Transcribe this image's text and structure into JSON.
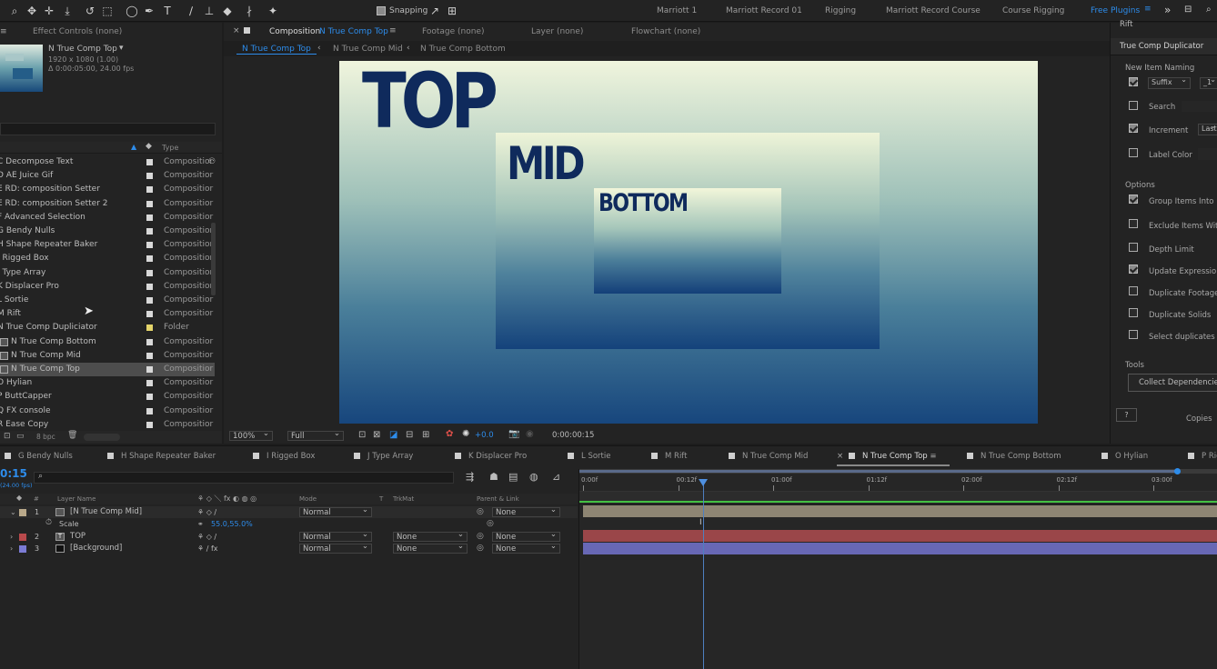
{
  "toolbar": {
    "snapping": "Snapping",
    "workspaces": [
      "Marriott 1",
      "Marriott Record 01",
      "Rigging",
      "Marriott Record Course",
      "Course Rigging",
      "Free Plugins"
    ]
  },
  "project": {
    "effect_controls": "Effect Controls (none)",
    "comp_name": "N True Comp Top",
    "comp_res": "1920 x 1080 (1.00)",
    "comp_dur": "Δ 0:00:05:00, 24.00 fps",
    "type_header": "Type",
    "items": [
      {
        "name": "C Decompose Text",
        "type": "Compositior"
      },
      {
        "name": "D AE Juice Gif",
        "type": "Compositior"
      },
      {
        "name": "E RD: composition Setter",
        "type": "Compositior"
      },
      {
        "name": "E RD: composition Setter 2",
        "type": "Compositior"
      },
      {
        "name": "F Advanced Selection",
        "type": "Compositior"
      },
      {
        "name": "G Bendy Nulls",
        "type": "Compositior"
      },
      {
        "name": "H Shape Repeater Baker",
        "type": "Compositior"
      },
      {
        "name": "I Rigged Box",
        "type": "Compositior"
      },
      {
        "name": "J Type Array",
        "type": "Compositior"
      },
      {
        "name": "K Displacer Pro",
        "type": "Compositior"
      },
      {
        "name": "L Sortie",
        "type": "Compositior"
      },
      {
        "name": "M Rift",
        "type": "Compositior"
      },
      {
        "name": "N True Comp Dupliciator",
        "type": "Folder"
      },
      {
        "name": "N True Comp Bottom",
        "type": "Compositior"
      },
      {
        "name": "N True Comp Mid",
        "type": "Compositior"
      },
      {
        "name": "N True Comp Top",
        "type": "Compositior"
      },
      {
        "name": "O Hylian",
        "type": "Compositior"
      },
      {
        "name": "P ButtCapper",
        "type": "Compositior"
      },
      {
        "name": "Q FX console",
        "type": "Compositior"
      },
      {
        "name": "R Ease Copy",
        "type": "Compositior"
      }
    ],
    "bpc": "8 bpc"
  },
  "viewer": {
    "tab_comp": "Composition",
    "tab_comp_name": "N True Comp Top",
    "tab_footage": "Footage (none)",
    "tab_layer": "Layer (none)",
    "tab_flowchart": "Flowchart (none)",
    "crumbs": [
      "N True Comp Top",
      "N True Comp Mid",
      "N True Comp Bottom"
    ],
    "text_top": "TOP",
    "text_mid": "MID",
    "text_bottom": "BOTTOM",
    "zoom": "100%",
    "quality": "Full",
    "exposure": "+0.0",
    "timecode": "0:00:00:15"
  },
  "tcd": {
    "rift": "Rift",
    "title": "True Comp Duplicator",
    "new_item_naming": "New Item Naming",
    "suffix": "Suffix",
    "suffix_value": "_1",
    "search": "Search",
    "increment": "Increment",
    "increment_value": "Last",
    "label_color": "Label Color",
    "options": "Options",
    "opt_group": "Group Items Into F",
    "opt_exclude": "Exclude Items With",
    "opt_depth": "Depth Limit",
    "opt_update": "Update Expressions",
    "opt_dup_footage": "Duplicate Footage",
    "opt_dup_solids": "Duplicate Solids",
    "opt_select": "Select duplicates",
    "tools": "Tools",
    "collect": "Collect Dependencies",
    "help": "?",
    "copies": "Copies"
  },
  "timeline": {
    "tabs": [
      "G Bendy Nulls",
      "H Shape Repeater Baker",
      "I Rigged Box",
      "J Type Array",
      "K Displacer Pro",
      "L Sortie",
      "M Rift",
      "N True Comp Mid",
      "N True Comp Top",
      "N True Comp Bottom",
      "O Hylian",
      "P Rig"
    ],
    "timecode": "0:15",
    "fps": "(24.00 fps)",
    "col_layer_name": "Layer Name",
    "col_mode": "Mode",
    "col_t": "T",
    "col_trkmat": "TrkMat",
    "col_parent": "Parent & Link",
    "layers": [
      {
        "num": "1",
        "name": "[N True Comp Mid]",
        "mode": "Normal",
        "trkmat": "",
        "parent": "None",
        "color": "#b9a98a"
      },
      {
        "num": "2",
        "name": "TOP",
        "mode": "Normal",
        "trkmat": "None",
        "parent": "None",
        "color": "#b8494b"
      },
      {
        "num": "3",
        "name": "[Background]",
        "mode": "Normal",
        "trkmat": "None",
        "parent": "None",
        "color": "#7b7bd4"
      }
    ],
    "scale_label": "Scale",
    "scale_value": "55.0,55.0%",
    "ruler": [
      "0:00f",
      "00:12f",
      "01:00f",
      "01:12f",
      "02:00f",
      "02:12f",
      "03:00f"
    ]
  },
  "colors": {
    "accent": "#2d8ceb",
    "mid_label": "#b3a990",
    "top_label": "#b54a4b",
    "bg_label": "#7d7ed8",
    "text_dark": "#0f2a5c"
  }
}
